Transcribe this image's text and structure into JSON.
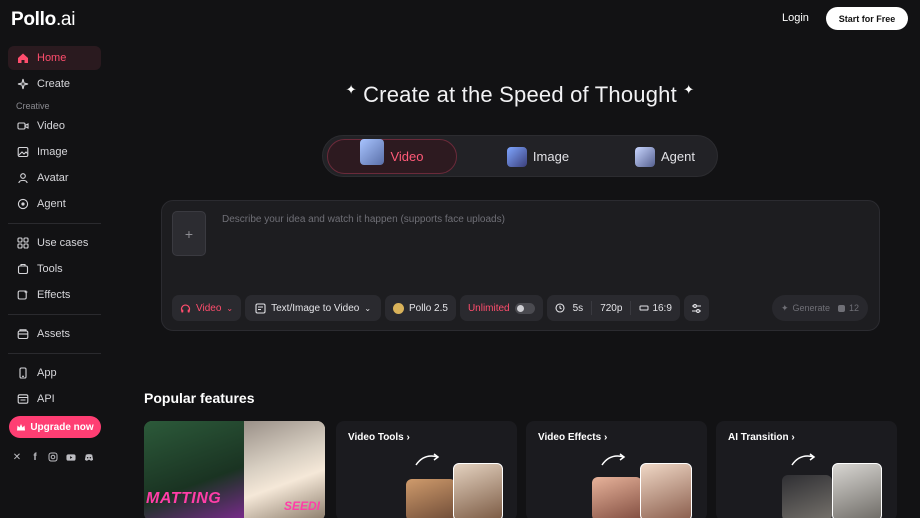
{
  "brand": {
    "logo_main": "Pollo",
    "logo_suffix": ".ai"
  },
  "header": {
    "login": "Login",
    "start": "Start for Free"
  },
  "sidebar": {
    "items": [
      {
        "label": "Home",
        "icon": "home-icon"
      },
      {
        "label": "Create",
        "icon": "sparkle-icon"
      },
      {
        "label": "Video",
        "icon": "video-icon"
      },
      {
        "label": "Image",
        "icon": "image-icon"
      },
      {
        "label": "Avatar",
        "icon": "avatar-icon"
      },
      {
        "label": "Agent",
        "icon": "agent-icon"
      },
      {
        "label": "Use cases",
        "icon": "grid-icon"
      },
      {
        "label": "Tools",
        "icon": "tools-icon"
      },
      {
        "label": "Effects",
        "icon": "effects-icon"
      },
      {
        "label": "Assets",
        "icon": "assets-icon"
      },
      {
        "label": "App",
        "icon": "phone-icon"
      },
      {
        "label": "API",
        "icon": "api-icon"
      }
    ],
    "section_creative": "Creative",
    "upgrade": "Upgrade now",
    "socials": [
      "x-icon",
      "facebook-icon",
      "instagram-icon",
      "youtube-icon",
      "discord-icon"
    ]
  },
  "hero": {
    "title": "Create at the Speed of Thought"
  },
  "modes": [
    {
      "label": "Video"
    },
    {
      "label": "Image"
    },
    {
      "label": "Agent"
    }
  ],
  "prompt": {
    "placeholder": "Describe your idea and watch it happen (supports face uploads)",
    "upload": "+",
    "chips": {
      "type": "Video",
      "mode": "Text/Image to Video",
      "model": "Pollo 2.5",
      "unlimited": "Unlimited",
      "duration": "5s",
      "resolution": "720p",
      "ratio": "16:9"
    },
    "generate": "Generate",
    "credits": "12"
  },
  "popular": {
    "title": "Popular features",
    "cards": [
      {
        "label_a": "MATTING",
        "label_b": "SEEDI"
      },
      {
        "title": "Video Tools"
      },
      {
        "title": "Video Effects"
      },
      {
        "title": "AI Transition"
      }
    ]
  },
  "colors": {
    "accent": "#ff3e73",
    "bg": "#121214",
    "active_text": "#ff4d6d"
  }
}
